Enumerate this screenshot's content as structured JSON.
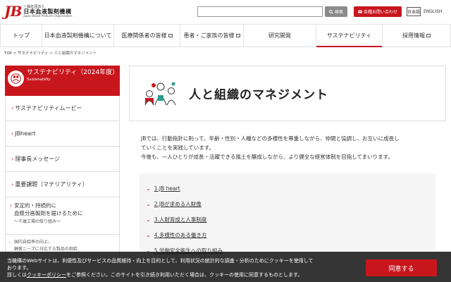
{
  "header": {
    "logo_mark": "JB",
    "logo_small": "一般社団法人",
    "logo_main": "日本血液製剤機構",
    "logo_en": "Japan Blood Products Organization",
    "search_placeholder": "",
    "search_label": "検索",
    "contact_label": "各種お問い合わせ",
    "lang_ja": "日本語",
    "lang_en": "ENGLISH"
  },
  "nav": {
    "items": [
      {
        "label": "トップ",
        "external": false
      },
      {
        "label": "日本血液製剤機構について",
        "external": false
      },
      {
        "label": "医療関係者の皆様",
        "external": true
      },
      {
        "label": "患者・ご家族の皆様",
        "external": true
      },
      {
        "label": "研究開発",
        "external": false
      },
      {
        "label": "サステナビリティ",
        "external": false,
        "active": true
      },
      {
        "label": "採用情報",
        "external": true
      }
    ]
  },
  "breadcrumb": {
    "top": "TOP",
    "sep": " > ",
    "section": "サステナビリティ",
    "current": "人と組織のマネジメント"
  },
  "sidebar": {
    "title": "サステナビリティ（2024年度）",
    "subtitle": "Sustainability",
    "items": [
      {
        "label": "サステナビリティムービー"
      },
      {
        "label": "JBheart"
      },
      {
        "label": "理事長メッセージ"
      },
      {
        "label": "重要課題（マテリアリティ）"
      }
    ],
    "multi": {
      "line1": "安定的・持続的に",
      "line2": "血漿分画製剤を届けるために",
      "line3": "〜千歳工場の取り組み〜"
    },
    "sub": {
      "line1": "国内自給率の向上、",
      "line2": "顧客ニーズに対応する製品の供給"
    }
  },
  "main": {
    "title": "人と組織のマネジメント",
    "intro_1": "JBでは、行動指針に則って、年齢・性別・人種などの多様性を尊重しながら、仲間と協調し、お互いに成長し",
    "intro_2": "ていくことを実践しています。",
    "intro_3": "今後も、一人ひとりが成長・活躍できる風土を醸成しながら、より健全な経営体制を目指してまいります。",
    "toc": [
      {
        "label": "1.JB heart"
      },
      {
        "label": "2.JBが求める人財像"
      },
      {
        "label": "3.人財育成と人事制度"
      },
      {
        "label": "4.多様性のある働き方"
      },
      {
        "label": "5.労働安全衛生への取り組み"
      }
    ]
  },
  "cookie": {
    "line1": "当機構のWebサイトは、利便性及びサービスの品質維持・向上を目的として、利用状況の統計的な調査・分析のためにクッキーを使用して",
    "line2": "おります。",
    "line3_pre": "詳しくは",
    "line3_link": "クッキーポリシー",
    "line3_post": "をご参照ください。このサイトを引き続き利用いただく場合は、クッキーの使用に同意するものとします。",
    "accept": "同意する"
  },
  "colors": {
    "brand": "#c8161d",
    "toc_bg": "#f5f5f5"
  }
}
